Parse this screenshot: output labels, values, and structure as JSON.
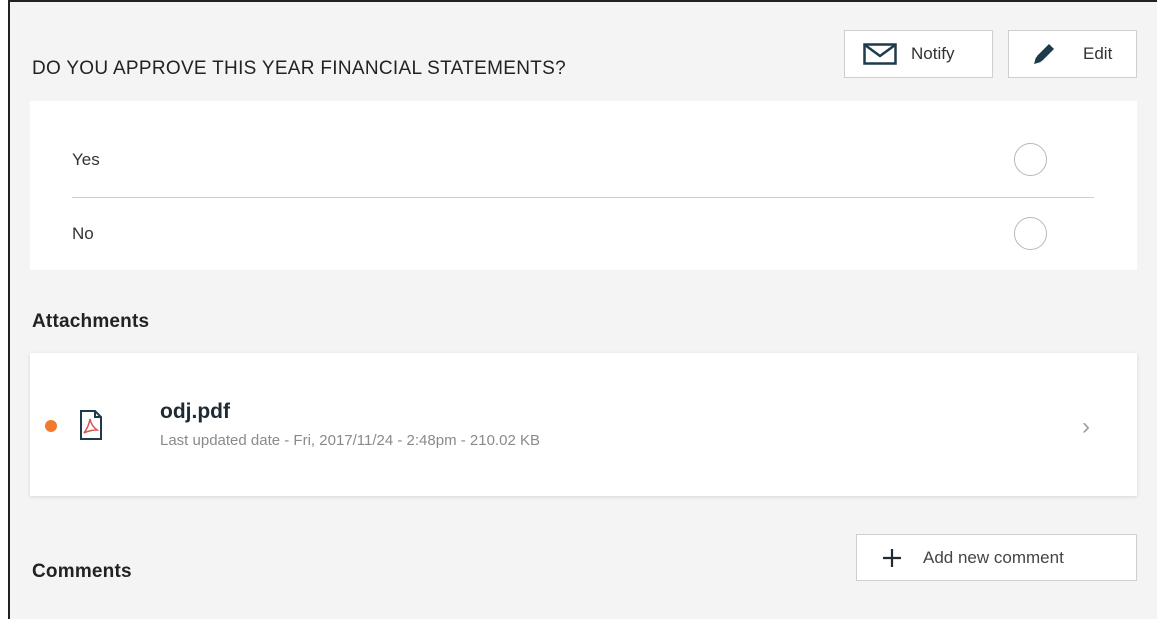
{
  "question": {
    "title": "DO YOU APPROVE THIS YEAR FINANCIAL STATEMENTS?",
    "notify_label": "Notify",
    "edit_label": "Edit",
    "options": [
      {
        "label": "Yes",
        "selected": false
      },
      {
        "label": "No",
        "selected": false
      }
    ]
  },
  "attachments": {
    "heading": "Attachments",
    "items": [
      {
        "name": "odj.pdf",
        "meta": "Last updated date - Fri, 2017/11/24 - 2:48pm - 210.02 KB",
        "status_color": "#f07b2e",
        "icon": "pdf-file-icon"
      }
    ]
  },
  "comments": {
    "heading": "Comments",
    "add_label": "Add new comment"
  }
}
